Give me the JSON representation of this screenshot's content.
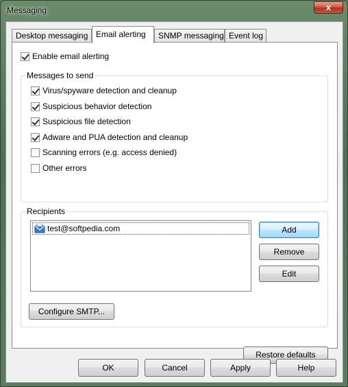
{
  "window": {
    "title": "Messaging",
    "close_label": "x"
  },
  "tabs": [
    {
      "label": "Desktop messaging"
    },
    {
      "label": "Email alerting"
    },
    {
      "label": "SNMP messaging"
    },
    {
      "label": "Event log"
    }
  ],
  "enable_email": {
    "label": "Enable email alerting",
    "checked": true
  },
  "messages_group": {
    "label": "Messages to send",
    "items": [
      {
        "label": "Virus/spyware detection and cleanup",
        "checked": true
      },
      {
        "label": "Suspicious behavior detection",
        "checked": true
      },
      {
        "label": "Suspicious file detection",
        "checked": true
      },
      {
        "label": "Adware and PUA detection and cleanup",
        "checked": true
      },
      {
        "label": "Scanning errors (e.g. access denied)",
        "checked": false
      },
      {
        "label": "Other errors",
        "checked": false
      }
    ]
  },
  "recipients_group": {
    "label": "Recipients",
    "items": [
      {
        "email": "test@softpedia.com",
        "icon": "email-icon"
      }
    ],
    "add_label": "Add",
    "remove_label": "Remove",
    "edit_label": "Edit",
    "configure_label": "Configure SMTP..."
  },
  "restore_label": "Restore defaults",
  "footer": {
    "ok_label": "OK",
    "cancel_label": "Cancel",
    "apply_label": "Apply",
    "help_label": "Help"
  }
}
